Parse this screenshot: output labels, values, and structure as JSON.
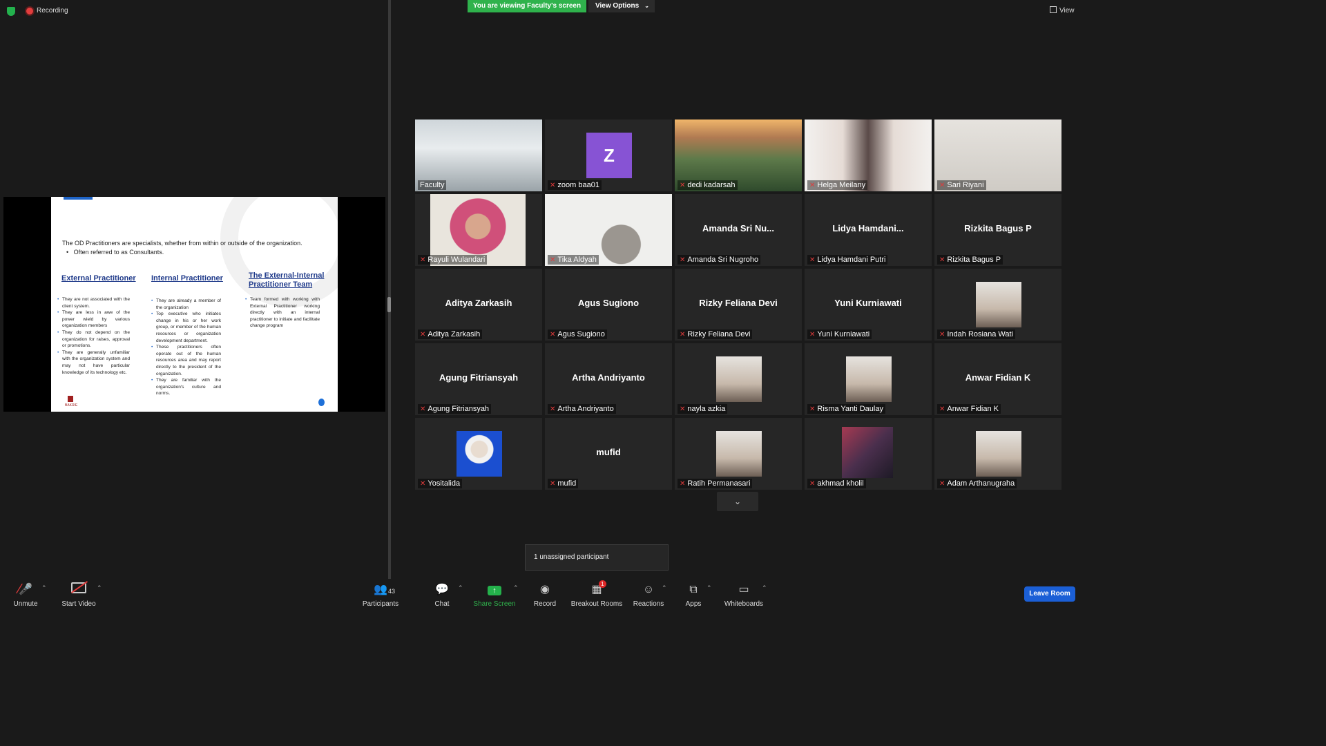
{
  "top": {
    "recording_label": "Recording",
    "viewing_banner": "You are viewing Faculty's screen",
    "view_options": "View Options",
    "view_label": "View"
  },
  "slide": {
    "intro": "The OD Practitioners are specialists, whether from within or outside of the organization.",
    "intro_bullet": "Often referred to as Consultants.",
    "logo_text": "BAKRIE",
    "columns": [
      {
        "heading": "External Practitioner",
        "bullets": [
          "They are not associated with the client system.",
          "They are less in awe of the power wield by various organization members",
          "They do not depend on the organization for raises, approval or promotions.",
          "They are generally unfamiliar with the organization system and may not have particular knowledge of its technology etc."
        ]
      },
      {
        "heading": "Internal Practitioner",
        "bullets": [
          "They are already a member of the organization",
          "Top executive who initiates change in his or her work group, or member of the human resources or organization development department.",
          "These practitioners often operate out of the human resources area and may report directly to the president of the organization.",
          "They are familiar with the organization's culture and norms."
        ]
      },
      {
        "heading": "The External-Internal Practitioner Team",
        "bullets": [
          "Team formed with working with External Practitioner working directly with an internal practitioner to initiate and facilitate change program"
        ]
      }
    ]
  },
  "participants": [
    {
      "name": "Faculty",
      "display": "",
      "video": "classroom",
      "active": true,
      "muted": false
    },
    {
      "name": "zoom baa01",
      "display": "",
      "video": "avatar-z",
      "avatar_letter": "Z",
      "muted": true
    },
    {
      "name": "dedi kadarsah",
      "display": "",
      "video": "landscape",
      "muted": true
    },
    {
      "name": "Helga Meilany",
      "display": "",
      "video": "hood",
      "muted": true
    },
    {
      "name": "Sari Riyani",
      "display": "",
      "video": "blur",
      "muted": true
    },
    {
      "name": "Rayuli Wulandari",
      "display": "",
      "video": "hijab-pink",
      "muted": true
    },
    {
      "name": "Tika Aldyah",
      "display": "",
      "video": "hijab-grey",
      "muted": true
    },
    {
      "name": "Amanda Sri Nugroho",
      "display": "Amanda Sri Nu...",
      "video": "none",
      "muted": true
    },
    {
      "name": "Lidya Hamdani Putri",
      "display": "Lidya  Hamdani...",
      "video": "none",
      "muted": true
    },
    {
      "name": "Rizkita Bagus P",
      "display": "Rizkita Bagus P",
      "video": "none",
      "muted": true
    },
    {
      "name": "Aditya Zarkasih",
      "display": "Aditya Zarkasih",
      "video": "none",
      "muted": true
    },
    {
      "name": "Agus Sugiono",
      "display": "Agus Sugiono",
      "video": "none",
      "muted": true
    },
    {
      "name": "Rizky Feliana Devi",
      "display": "Rizky Feliana Devi",
      "video": "none",
      "muted": true
    },
    {
      "name": "Yuni Kurniawati",
      "display": "Yuni Kurniawati",
      "video": "none",
      "muted": true
    },
    {
      "name": "Indah Rosiana Wati",
      "display": "",
      "video": "profile",
      "muted": true
    },
    {
      "name": "Agung Fitriansyah",
      "display": "Agung Fitriansyah",
      "video": "none",
      "muted": true
    },
    {
      "name": "Artha Andriyanto",
      "display": "Artha Andriyanto",
      "video": "none",
      "muted": true
    },
    {
      "name": "nayla azkia",
      "display": "",
      "video": "profile",
      "muted": true
    },
    {
      "name": "Risma Yanti Daulay",
      "display": "",
      "video": "profile",
      "muted": true
    },
    {
      "name": "Anwar Fidian K",
      "display": "Anwar Fidian K",
      "video": "none",
      "muted": true
    },
    {
      "name": "Yositalida",
      "display": "",
      "video": "profile-blue",
      "muted": true
    },
    {
      "name": "mufid",
      "display": "mufid",
      "video": "none",
      "muted": true
    },
    {
      "name": "Ratih Permanasari",
      "display": "",
      "video": "profile",
      "muted": true
    },
    {
      "name": "akhmad kholil",
      "display": "",
      "video": "profile-dark",
      "muted": true
    },
    {
      "name": "Adam Arthanugraha",
      "display": "",
      "video": "profile",
      "muted": true
    }
  ],
  "unassigned_text": "1 unassigned participant",
  "toolbar": {
    "unmute": "Unmute",
    "start_video": "Start Video",
    "participants": "Participants",
    "participants_count": "43",
    "chat": "Chat",
    "share_screen": "Share Screen",
    "record": "Record",
    "breakout_rooms": "Breakout Rooms",
    "breakout_badge": "1",
    "reactions": "Reactions",
    "apps": "Apps",
    "whiteboards": "Whiteboards",
    "leave_room": "Leave Room"
  },
  "colors": {
    "accent_green": "#2fb24c",
    "leave_blue": "#1b5fd6",
    "active_border": "#c8e05a",
    "muted_red": "#e03b3b",
    "avatar_purple": "#8753d4"
  }
}
